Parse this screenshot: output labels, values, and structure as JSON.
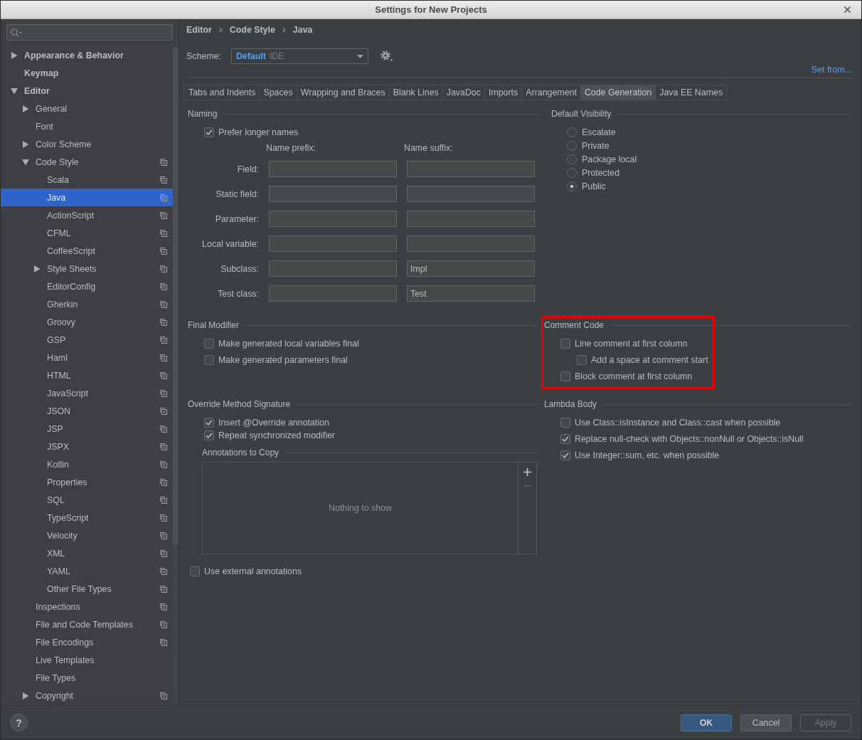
{
  "window": {
    "title": "Settings for New Projects"
  },
  "sidebar": {
    "items": [
      {
        "label": "Appearance & Behavior",
        "selected": false,
        "expanded": false,
        "project_icon": false
      },
      {
        "label": "Keymap",
        "selected": false,
        "project_icon": false
      },
      {
        "label": "Editor",
        "selected": false,
        "expanded": true,
        "project_icon": false,
        "children": [
          {
            "label": "General",
            "selected": false,
            "expanded": false,
            "project_icon": false
          },
          {
            "label": "Font",
            "selected": false,
            "project_icon": false
          },
          {
            "label": "Color Scheme",
            "selected": false,
            "expanded": false,
            "project_icon": false
          },
          {
            "label": "Code Style",
            "selected": false,
            "expanded": true,
            "project_icon": true,
            "children": [
              {
                "label": "Scala",
                "selected": false,
                "project_icon": true
              },
              {
                "label": "Java",
                "selected": true,
                "project_icon": true
              },
              {
                "label": "ActionScript",
                "selected": false,
                "project_icon": true
              },
              {
                "label": "CFML",
                "selected": false,
                "project_icon": true
              },
              {
                "label": "CoffeeScript",
                "selected": false,
                "project_icon": true
              },
              {
                "label": "Style Sheets",
                "selected": false,
                "expanded": false,
                "project_icon": true
              },
              {
                "label": "EditorConfig",
                "selected": false,
                "project_icon": true
              },
              {
                "label": "Gherkin",
                "selected": false,
                "project_icon": true
              },
              {
                "label": "Groovy",
                "selected": false,
                "project_icon": true
              },
              {
                "label": "GSP",
                "selected": false,
                "project_icon": true
              },
              {
                "label": "Haml",
                "selected": false,
                "project_icon": true
              },
              {
                "label": "HTML",
                "selected": false,
                "project_icon": true
              },
              {
                "label": "JavaScript",
                "selected": false,
                "project_icon": true
              },
              {
                "label": "JSON",
                "selected": false,
                "project_icon": true
              },
              {
                "label": "JSP",
                "selected": false,
                "project_icon": true
              },
              {
                "label": "JSPX",
                "selected": false,
                "project_icon": true
              },
              {
                "label": "Kotlin",
                "selected": false,
                "project_icon": true
              },
              {
                "label": "Properties",
                "selected": false,
                "project_icon": true
              },
              {
                "label": "SQL",
                "selected": false,
                "project_icon": true
              },
              {
                "label": "TypeScript",
                "selected": false,
                "project_icon": true
              },
              {
                "label": "Velocity",
                "selected": false,
                "project_icon": true
              },
              {
                "label": "XML",
                "selected": false,
                "project_icon": true
              },
              {
                "label": "YAML",
                "selected": false,
                "project_icon": true
              },
              {
                "label": "Other File Types",
                "selected": false,
                "project_icon": true
              }
            ]
          },
          {
            "label": "Inspections",
            "selected": false,
            "project_icon": true
          },
          {
            "label": "File and Code Templates",
            "selected": false,
            "project_icon": true
          },
          {
            "label": "File Encodings",
            "selected": false,
            "project_icon": true
          },
          {
            "label": "Live Templates",
            "selected": false,
            "project_icon": false
          },
          {
            "label": "File Types",
            "selected": false,
            "project_icon": false
          },
          {
            "label": "Copyright",
            "selected": false,
            "expanded": false,
            "project_icon": true
          }
        ]
      }
    ]
  },
  "breadcrumb": [
    "Editor",
    "Code Style",
    "Java"
  ],
  "scheme": {
    "label": "Scheme:",
    "name": "Default",
    "scope": "IDE"
  },
  "set_from_link": "Set from...",
  "tabs": [
    {
      "label": "Tabs and Indents",
      "selected": false
    },
    {
      "label": "Spaces",
      "selected": false
    },
    {
      "label": "Wrapping and Braces",
      "selected": false
    },
    {
      "label": "Blank Lines",
      "selected": false
    },
    {
      "label": "JavaDoc",
      "selected": false
    },
    {
      "label": "Imports",
      "selected": false
    },
    {
      "label": "Arrangement",
      "selected": false
    },
    {
      "label": "Code Generation",
      "selected": true
    },
    {
      "label": "Java EE Names",
      "selected": false
    }
  ],
  "naming": {
    "title": "Naming",
    "prefer_longer": {
      "label": "Prefer longer names",
      "checked": true
    },
    "prefix_header": "Name prefix:",
    "suffix_header": "Name suffix:",
    "rows": [
      {
        "label": "Field:"
      },
      {
        "label": "Static field:"
      },
      {
        "label": "Parameter:"
      },
      {
        "label": "Local variable:"
      },
      {
        "label": "Subclass:",
        "suffix": "Impl"
      },
      {
        "label": "Test class:",
        "suffix": "Test"
      }
    ]
  },
  "default_visibility": {
    "title": "Default Visibility",
    "options": [
      {
        "label": "Escalate",
        "selected": false
      },
      {
        "label": "Private",
        "selected": false
      },
      {
        "label": "Package local",
        "selected": false
      },
      {
        "label": "Protected",
        "selected": false
      },
      {
        "label": "Public",
        "selected": true
      }
    ]
  },
  "final_modifier": {
    "title": "Final Modifier",
    "options": [
      {
        "label": "Make generated local variables final",
        "checked": false
      },
      {
        "label": "Make generated parameters final",
        "checked": false
      }
    ]
  },
  "comment_code": {
    "title": "Comment Code",
    "highlighted": true,
    "options": [
      {
        "label": "Line comment at first column",
        "checked": false,
        "children": [
          {
            "label": "Add a space at comment start",
            "checked": false
          }
        ]
      },
      {
        "label": "Block comment at first column",
        "checked": false
      }
    ]
  },
  "override_method_signature": {
    "title": "Override Method Signature",
    "options": [
      {
        "label": "Insert @Override annotation",
        "checked": true
      },
      {
        "label": "Repeat synchronized modifier",
        "checked": true
      }
    ],
    "annotations_to_copy": {
      "title": "Annotations to Copy",
      "empty_text": "Nothing to show",
      "actions": [
        {
          "kind": "add",
          "disabled": false
        },
        {
          "kind": "remove",
          "disabled": true
        }
      ]
    }
  },
  "use_external_annotations": {
    "label": "Use external annotations",
    "checked": false
  },
  "lambda_body": {
    "title": "Lambda Body",
    "options": [
      {
        "label": "Use Class::isInstance and Class::cast when possible",
        "checked": false
      },
      {
        "label": "Replace null-check with Objects::nonNull or Objects::isNull",
        "checked": true
      },
      {
        "label": "Use Integer::sum, etc. when possible",
        "checked": true
      }
    ]
  },
  "help": {
    "label": "?"
  },
  "buttons": [
    {
      "label": "OK",
      "kind": "default",
      "disabled": false
    },
    {
      "label": "Cancel",
      "kind": "normal",
      "disabled": false
    },
    {
      "label": "Apply",
      "kind": "normal",
      "disabled": true
    }
  ]
}
